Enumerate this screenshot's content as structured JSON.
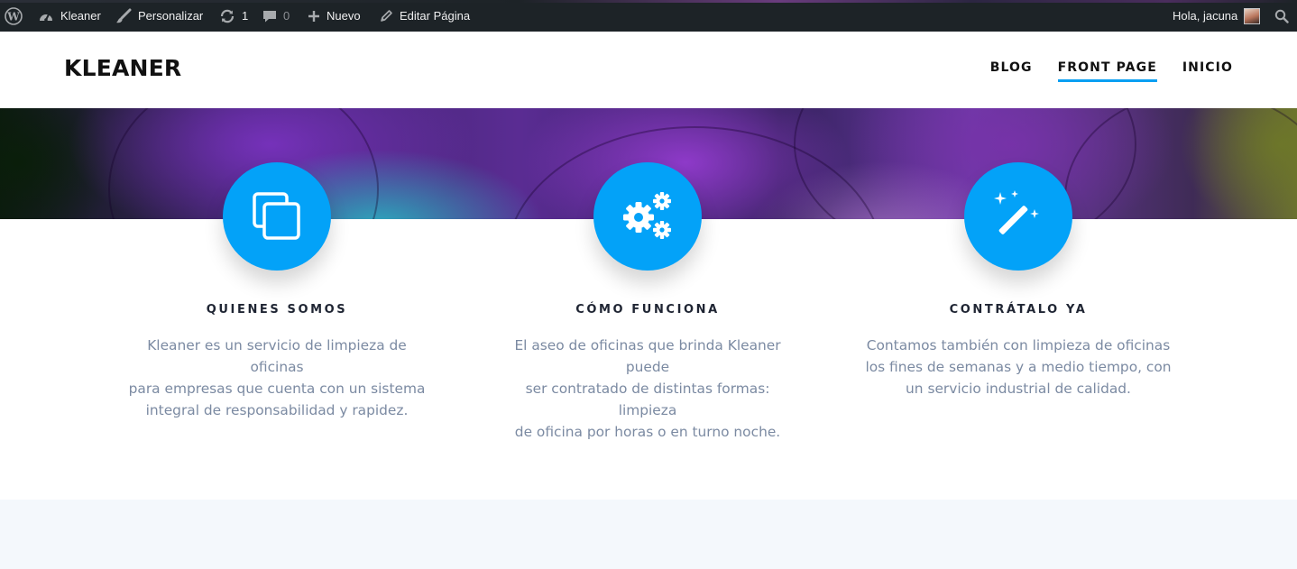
{
  "adminbar": {
    "site_name": "Kleaner",
    "customize_label": "Personalizar",
    "updates_count": "1",
    "comments_count": "0",
    "new_label": "Nuevo",
    "edit_label": "Editar Página",
    "greeting": "Hola, jacuna"
  },
  "header": {
    "brand": "KLEANER",
    "nav": [
      {
        "label": "BLOG",
        "active": false
      },
      {
        "label": "FRONT PAGE",
        "active": true
      },
      {
        "label": "INICIO",
        "active": false
      }
    ]
  },
  "colors": {
    "accent": "#03a2f8",
    "admin_bar": "#1d2327",
    "heading": "#1f2533",
    "body_text": "#7b8aa2",
    "lower_band": "#f4f8fc"
  },
  "features": [
    {
      "icon": "copy-icon",
      "title": "QUIENES SOMOS",
      "lines": [
        "Kleaner es un servicio de limpieza de oficinas",
        "para empresas que cuenta con un sistema",
        "integral de responsabilidad y rapidez."
      ]
    },
    {
      "icon": "gears-icon",
      "title": "CÓMO FUNCIONA",
      "lines": [
        "El aseo de oficinas que brinda Kleaner puede",
        "ser contratado de distintas formas: limpieza",
        "de oficina por horas o en turno noche."
      ]
    },
    {
      "icon": "magic-wand-icon",
      "title": "CONTRÁTALO YA",
      "lines": [
        "Contamos también con limpieza de oficinas",
        "los fines de semanas y a medio tiempo, con",
        "un servicio industrial de calidad."
      ]
    }
  ]
}
